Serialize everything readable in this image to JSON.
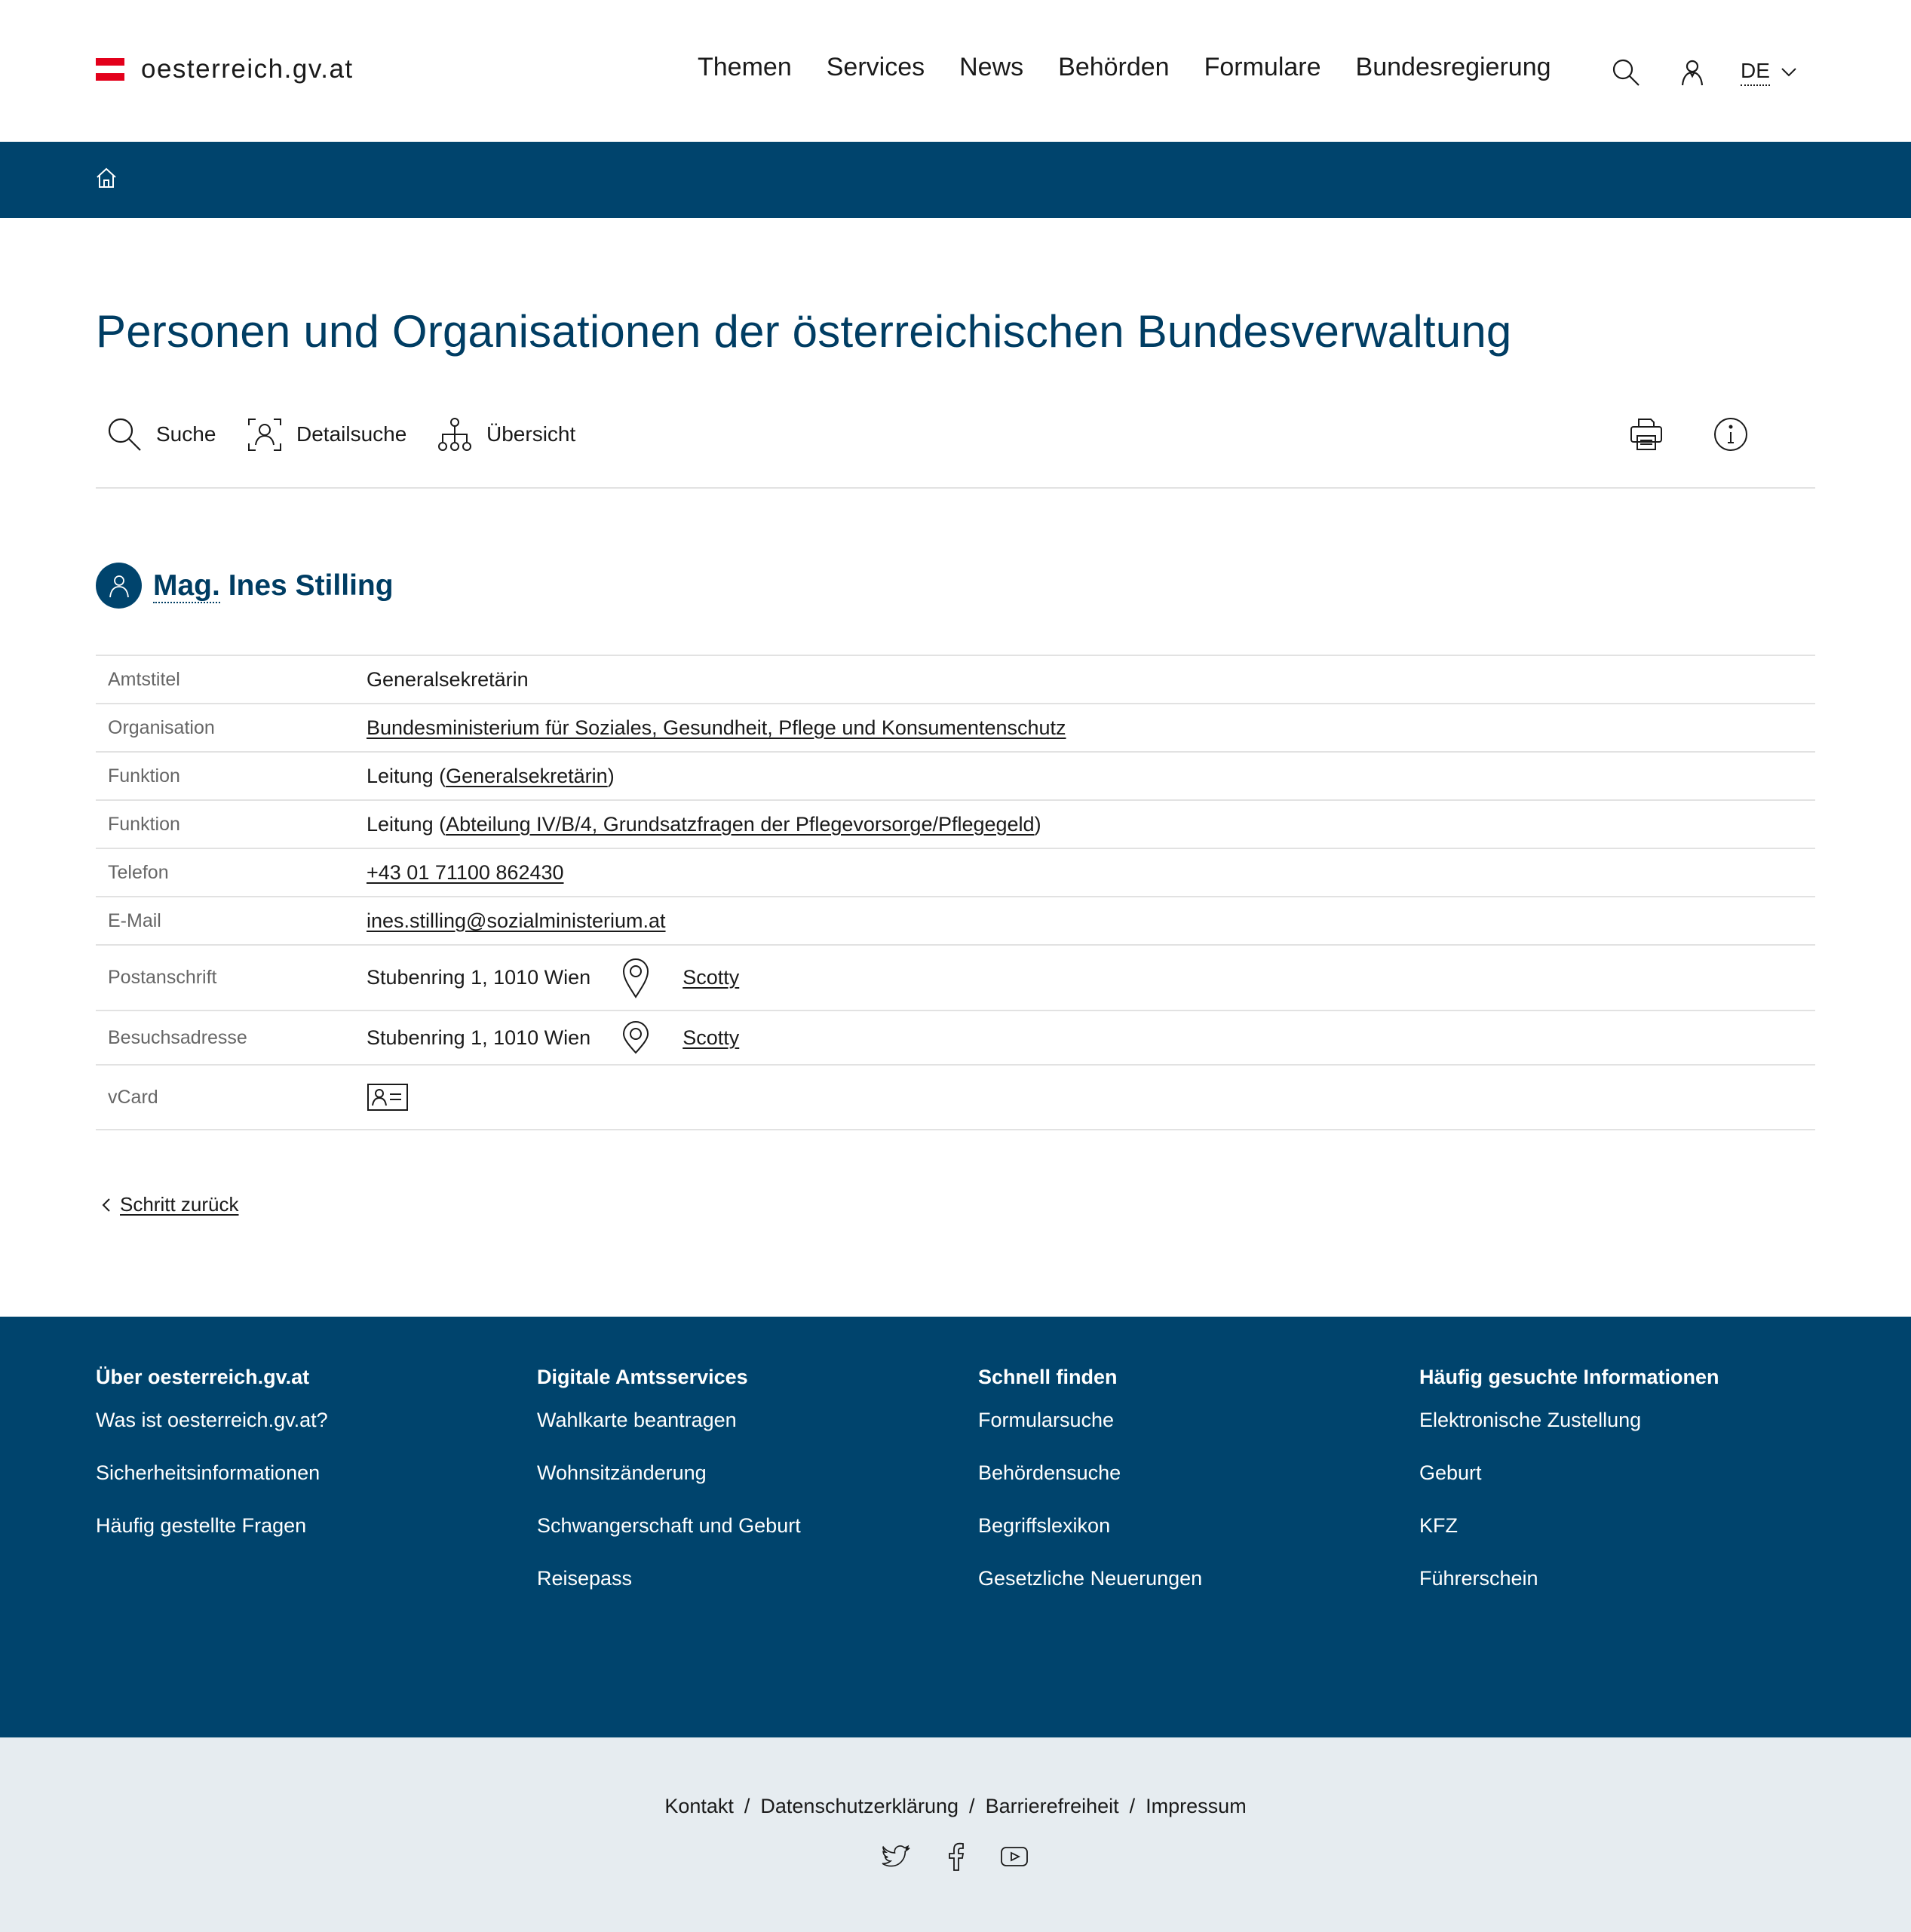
{
  "header": {
    "logo_text": "oesterreich.gv.at",
    "nav": [
      "Themen",
      "Services",
      "News",
      "Behörden",
      "Formulare",
      "Bundesregierung"
    ],
    "language": "DE"
  },
  "page_title": "Personen und Organisationen der österreichischen Bundesverwaltung",
  "toolbar": {
    "search": "Suche",
    "detail_search": "Detailsuche",
    "overview": "Übersicht"
  },
  "person": {
    "title": "Mag.",
    "name": "Ines Stilling"
  },
  "details": {
    "amtstitel": {
      "label": "Amtstitel",
      "value": "Generalsekretärin"
    },
    "organisation": {
      "label": "Organisation",
      "value": "Bundesministerium für Soziales, Gesundheit, Pflege und Konsumentenschutz"
    },
    "funktion1": {
      "label": "Funktion",
      "prefix": "Leitung (",
      "link": "Generalsekretärin",
      "suffix": ")"
    },
    "funktion2": {
      "label": "Funktion",
      "prefix": "Leitung (",
      "link": "Abteilung IV/B/4, Grundsatzfragen der Pflegevorsorge/Pflegegeld",
      "suffix": ")"
    },
    "telefon": {
      "label": "Telefon",
      "value": "+43 01 71100 862430"
    },
    "email": {
      "label": "E-Mail",
      "value": "ines.stilling@sozialministerium.at"
    },
    "postanschrift": {
      "label": "Postanschrift",
      "value": "Stubenring 1, 1010 Wien",
      "map_link": "Scotty"
    },
    "besuchsadresse": {
      "label": "Besuchsadresse",
      "value": "Stubenring 1, 1010 Wien",
      "map_link": "Scotty"
    },
    "vcard": {
      "label": "vCard"
    }
  },
  "back_link": "Schritt zurück",
  "footer": {
    "columns": [
      {
        "heading": "Über oesterreich.gv.at",
        "links": [
          "Was ist oesterreich.gv.at?",
          "Sicherheitsinformationen",
          "Häufig gestellte Fragen"
        ]
      },
      {
        "heading": "Digitale Amtsservices",
        "links": [
          "Wahlkarte beantragen",
          "Wohnsitzänderung",
          "Schwangerschaft und Geburt",
          "Reisepass"
        ]
      },
      {
        "heading": "Schnell finden",
        "links": [
          "Formularsuche",
          "Behördensuche",
          "Begriffslexikon",
          "Gesetzliche Neuerungen"
        ]
      },
      {
        "heading": "Häufig gesuchte Informationen",
        "links": [
          "Elektronische Zustellung",
          "Geburt",
          "KFZ",
          "Führerschein"
        ]
      }
    ],
    "legal": [
      "Kontakt",
      "Datenschutzerklärung",
      "Barrierefreiheit",
      "Impressum"
    ],
    "legal_separator": "/"
  },
  "colors": {
    "brand_blue": "#00446d",
    "title_blue": "#003d63",
    "flag_red": "#e3001b",
    "subfooter_bg": "#e6ecf0"
  }
}
